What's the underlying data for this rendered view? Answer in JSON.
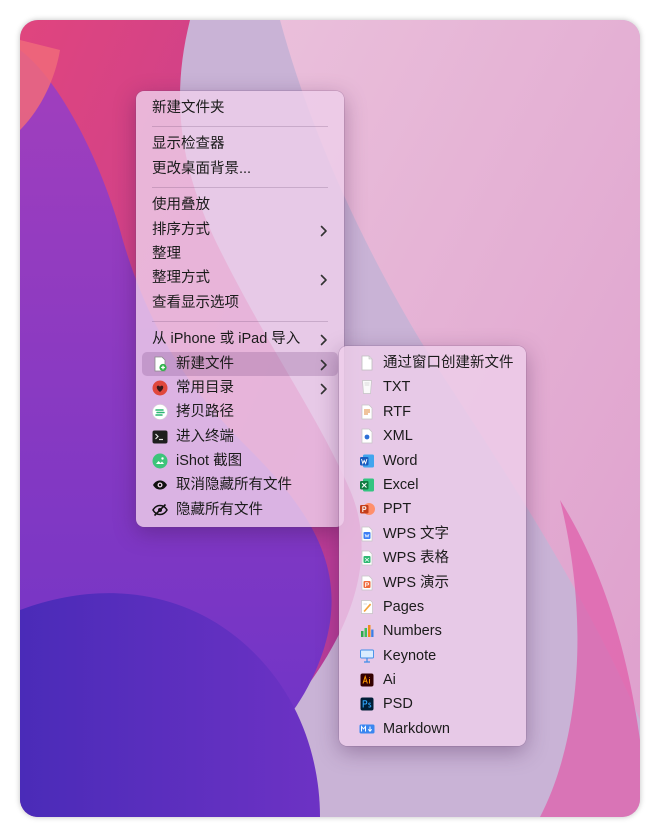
{
  "context_menu": {
    "sections": [
      [
        {
          "label": "新建文件夹"
        }
      ],
      [
        {
          "label": "显示检查器"
        },
        {
          "label": "更改桌面背景..."
        }
      ],
      [
        {
          "label": "使用叠放"
        },
        {
          "label": "排序方式",
          "submenu": true
        },
        {
          "label": "整理"
        },
        {
          "label": "整理方式",
          "submenu": true
        },
        {
          "label": "查看显示选项"
        }
      ],
      [
        {
          "label": "从 iPhone 或 iPad 导入",
          "submenu": true
        },
        {
          "label": "新建文件",
          "icon": "new-file-icon",
          "submenu": true,
          "highlighted": true
        },
        {
          "label": "常用目录",
          "icon": "heart-icon",
          "submenu": true
        },
        {
          "label": "拷贝路径",
          "icon": "copy-path-icon"
        },
        {
          "label": "进入终端",
          "icon": "terminal-icon"
        },
        {
          "label": "iShot 截图",
          "icon": "screenshot-icon"
        },
        {
          "label": "取消隐藏所有文件",
          "icon": "eye-icon"
        },
        {
          "label": "隐藏所有文件",
          "icon": "eye-slash-icon"
        }
      ]
    ]
  },
  "new_file_submenu": {
    "items": [
      {
        "label": "通过窗口创建新文件",
        "icon": "blank-doc-icon"
      },
      {
        "label": "TXT",
        "icon": "txt-icon"
      },
      {
        "label": "RTF",
        "icon": "rtf-icon"
      },
      {
        "label": "XML",
        "icon": "xml-icon"
      },
      {
        "label": "Word",
        "icon": "word-icon"
      },
      {
        "label": "Excel",
        "icon": "excel-icon"
      },
      {
        "label": "PPT",
        "icon": "ppt-icon"
      },
      {
        "label": "WPS 文字",
        "icon": "wps-writer-icon"
      },
      {
        "label": "WPS 表格",
        "icon": "wps-sheet-icon"
      },
      {
        "label": "WPS 演示",
        "icon": "wps-present-icon"
      },
      {
        "label": "Pages",
        "icon": "pages-icon"
      },
      {
        "label": "Numbers",
        "icon": "numbers-icon"
      },
      {
        "label": "Keynote",
        "icon": "keynote-icon"
      },
      {
        "label": "Ai",
        "icon": "illustrator-icon"
      },
      {
        "label": "PSD",
        "icon": "photoshop-icon"
      },
      {
        "label": "Markdown",
        "icon": "markdown-icon"
      }
    ]
  }
}
